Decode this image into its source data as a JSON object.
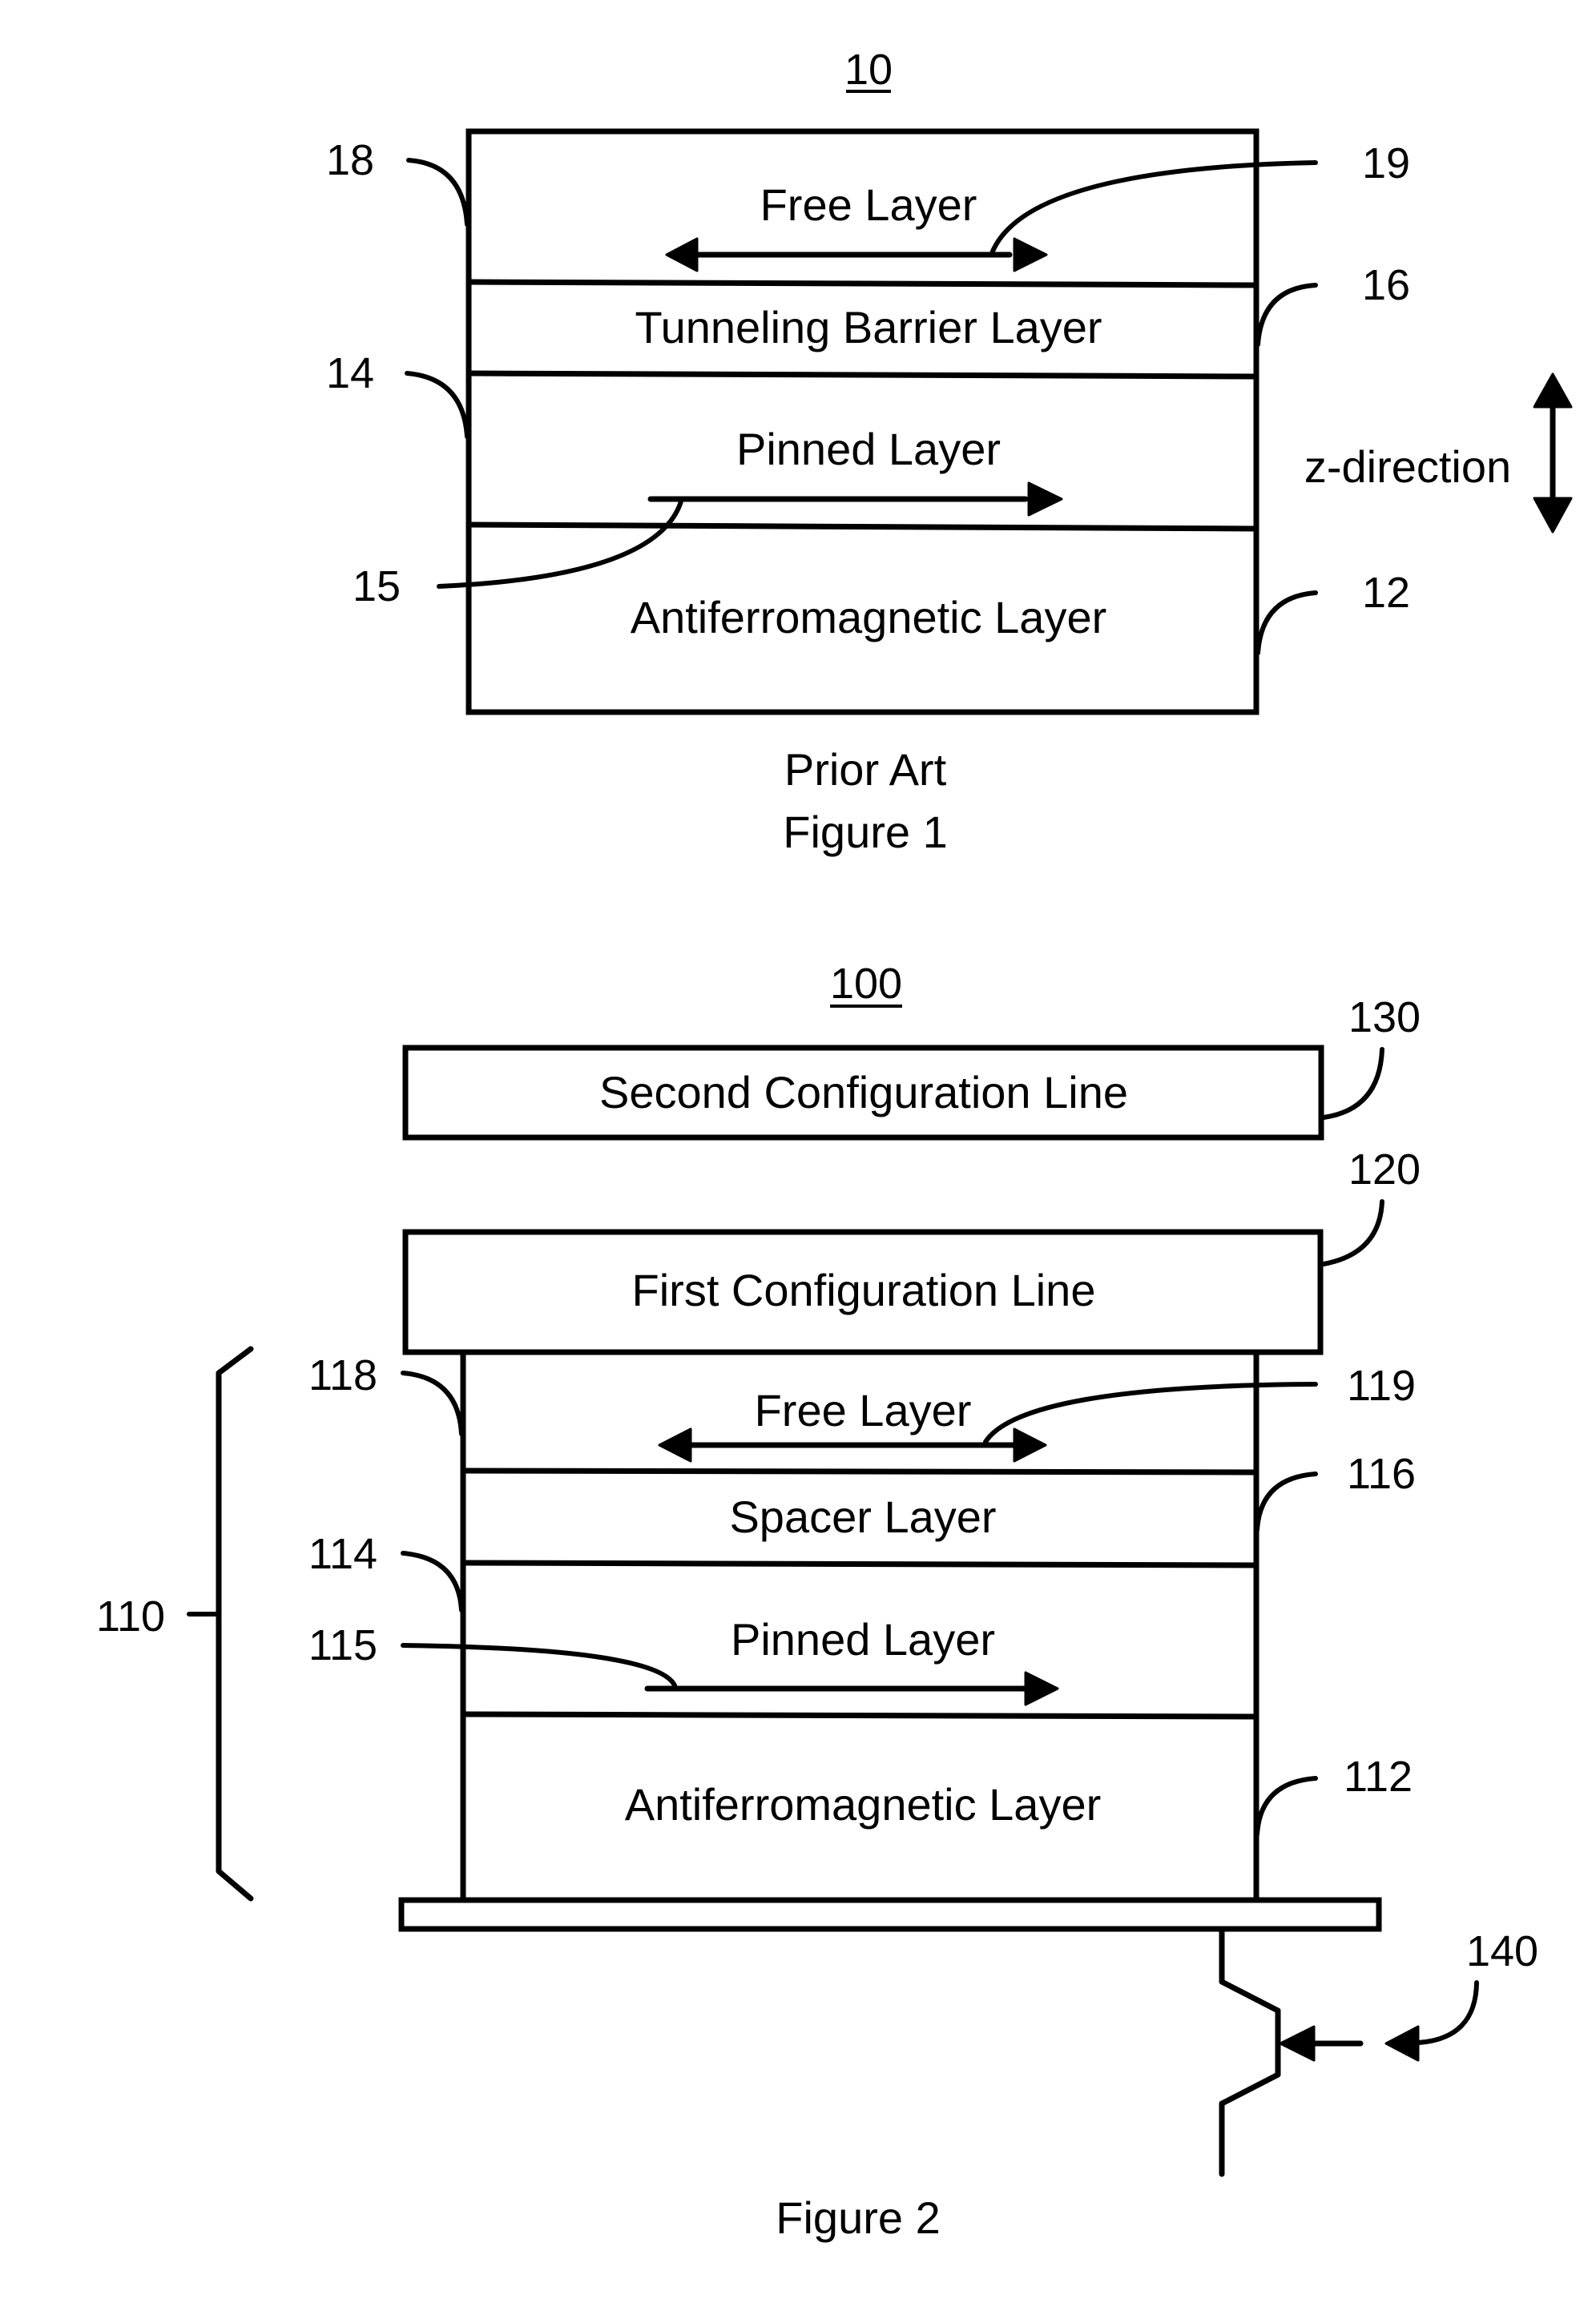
{
  "figure1": {
    "ref_number": "10",
    "layers": {
      "free": "Free Layer",
      "tunneling_barrier": "Tunneling Barrier Layer",
      "pinned": "Pinned Layer",
      "antiferromagnetic": "Antiferromagnetic Layer"
    },
    "refs": {
      "free_layer": "18",
      "free_magnetization": "19",
      "tunneling_barrier": "16",
      "pinned_layer": "14",
      "pinned_magnetization": "15",
      "antiferromagnetic": "12"
    },
    "direction_label": "z-direction",
    "caption_prior_art": "Prior Art",
    "caption": "Figure 1"
  },
  "figure2": {
    "ref_number": "100",
    "second_config_line": "Second Configuration Line",
    "first_config_line": "First Configuration Line",
    "layers": {
      "free": "Free Layer",
      "spacer": "Spacer Layer",
      "pinned": "Pinned Layer",
      "antiferromagnetic": "Antiferromagnetic Layer"
    },
    "refs": {
      "second_config_line": "130",
      "first_config_line": "120",
      "stack": "110",
      "free_layer": "118",
      "free_magnetization": "119",
      "spacer_layer": "116",
      "pinned_layer": "114",
      "pinned_magnetization": "115",
      "antiferromagnetic": "112",
      "transistor": "140"
    },
    "caption": "Figure 2"
  }
}
